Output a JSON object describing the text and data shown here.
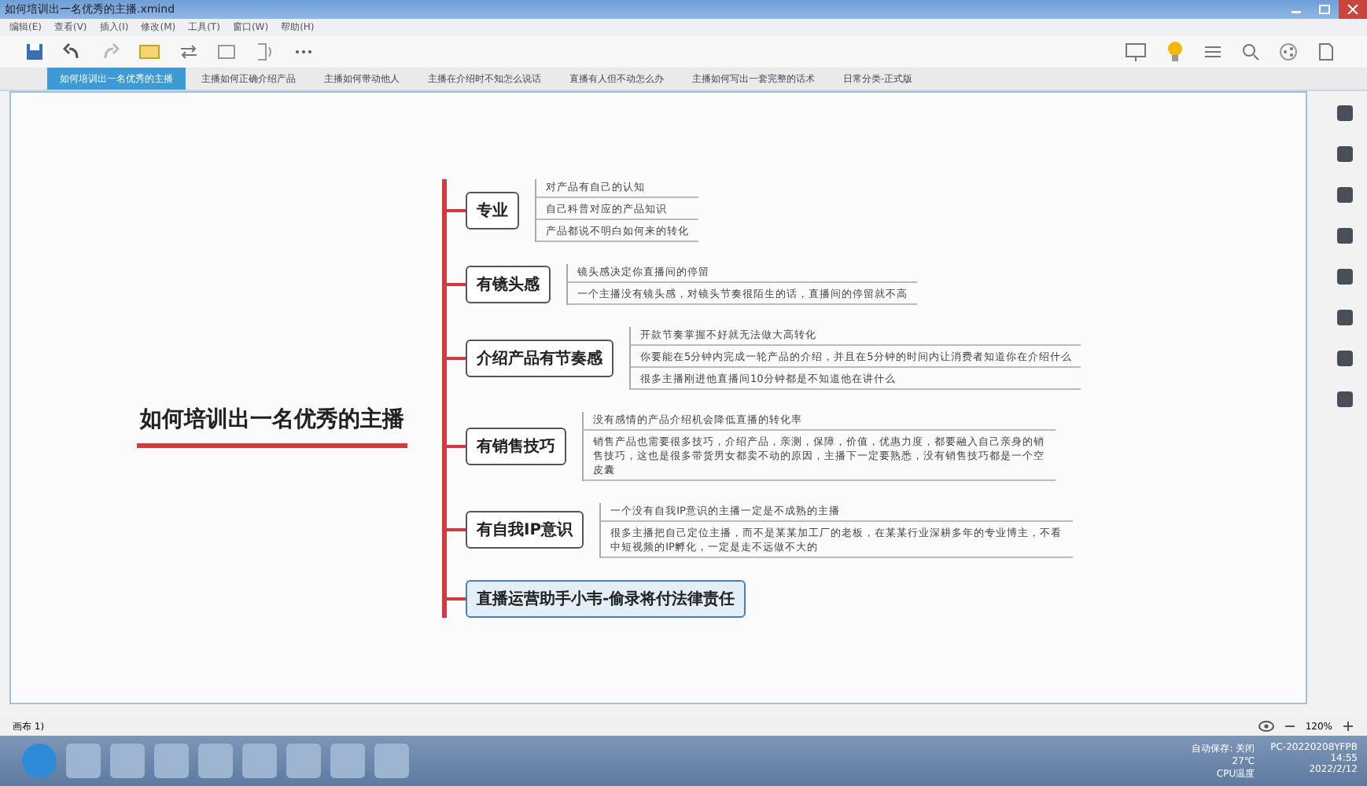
{
  "window": {
    "title": "如何培训出一名优秀的主播.xmind"
  },
  "menu": [
    "编辑(E)",
    "查看(V)",
    "插入(I)",
    "修改(M)",
    "工具(T)",
    "窗口(W)",
    "帮助(H)"
  ],
  "tabs": [
    {
      "label": "如何培训出一名优秀的主播",
      "selected": true
    },
    {
      "label": "主播如何正确介绍产品",
      "selected": false
    },
    {
      "label": "主播如何带动他人",
      "selected": false
    },
    {
      "label": "主播在介绍时不知怎么说话",
      "selected": false
    },
    {
      "label": "直播有人但不动怎么办",
      "selected": false
    },
    {
      "label": "主播如何写出一套完整的话术",
      "selected": false
    },
    {
      "label": "日常分类-正式版",
      "selected": false
    }
  ],
  "mindmap": {
    "central": "如何培训出一名优秀的主播",
    "branches": [
      {
        "label": "专业",
        "selected": false,
        "notes": [
          "对产品有自己的认知",
          "自己科普对应的产品知识",
          "产品都说不明白如何来的转化"
        ]
      },
      {
        "label": "有镜头感",
        "selected": false,
        "notes": [
          "镜头感决定你直播间的停留",
          "一个主播没有镜头感，对镜头节奏很陌生的话，直播间的停留就不高"
        ]
      },
      {
        "label": "介绍产品有节奏感",
        "selected": false,
        "notes": [
          "开款节奏掌握不好就无法做大高转化",
          "你要能在5分钟内完成一轮产品的介绍，并且在5分钟的时间内让消费者知道你在介绍什么",
          "很多主播刚进他直播间10分钟都是不知道他在讲什么"
        ]
      },
      {
        "label": "有销售技巧",
        "selected": false,
        "notes": [
          "没有感情的产品介绍机会降低直播的转化率",
          "销售产品也需要很多技巧，介绍产品，亲测，保障，价值，优惠力度，都要融入自己亲身的销售技巧，这也是很多带货男女都卖不动的原因，主播下一定要熟悉，没有销售技巧都是一个空皮囊"
        ]
      },
      {
        "label": "有自我IP意识",
        "selected": false,
        "notes": [
          "一个没有自我IP意识的主播一定是不成熟的主播",
          "很多主播把自己定位主播，而不是某某加工厂的老板，在某某行业深耕多年的专业博主，不看中短视频的IP孵化，一定是走不远做不大的"
        ]
      },
      {
        "label": "直播运营助手小韦-偷录将付法律责任",
        "selected": true
      }
    ]
  },
  "status_bar": {
    "left": "画布 1)",
    "zoom": "120%",
    "autosave": "自动保存: 关闭",
    "computer": "PC-20220208YFPB"
  },
  "taskbar": {
    "temperature": "27℃",
    "temperature_label": "CPU温度",
    "time": "14:55",
    "date": "2022/2/12"
  }
}
